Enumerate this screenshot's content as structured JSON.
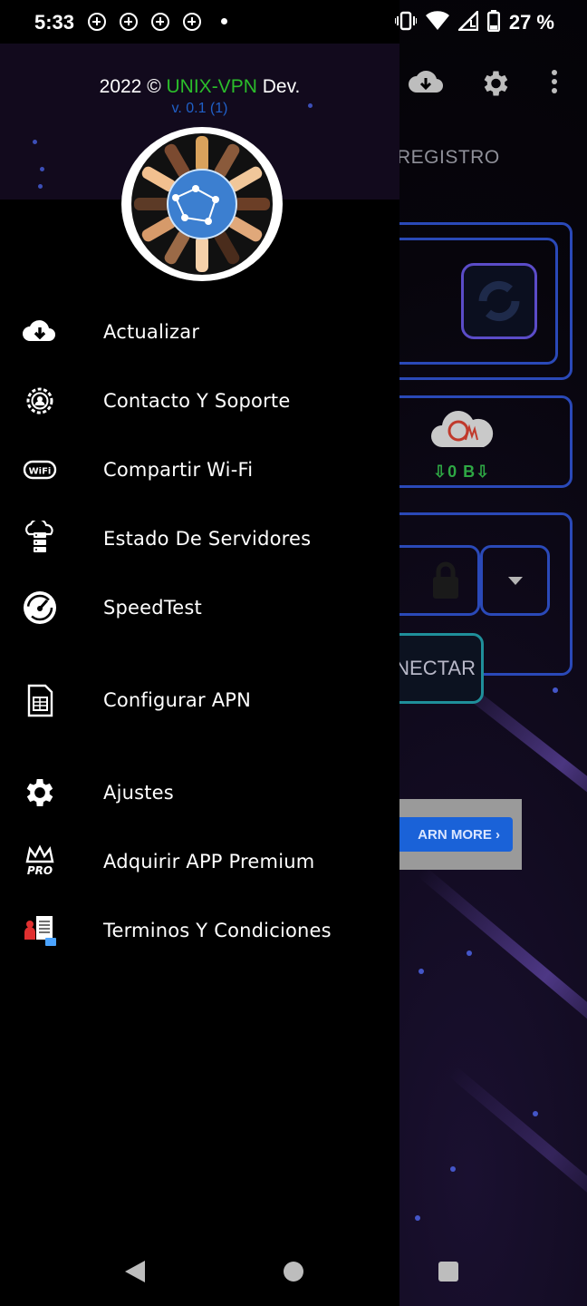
{
  "status_bar": {
    "time": "5:33",
    "battery_percent": "27 %",
    "notification_icons": [
      "vpn-key-icon",
      "vpn-key-icon",
      "vpn-key-icon",
      "vpn-key-icon"
    ]
  },
  "background_app": {
    "tab_registro": "REGISTRO",
    "connect_label": "NECTAR",
    "traffic_label": "⇩0 B⇩",
    "ad_button": "ARN MORE  ›"
  },
  "drawer": {
    "header": {
      "year": "2022 ©",
      "brand": "UNIX-VPN",
      "suffix": "Dev.",
      "version": "v. 0.1 (1)"
    },
    "menu": [
      {
        "label": "Actualizar",
        "icon": "cloud-download-icon"
      },
      {
        "label": "Contacto Y Soporte",
        "icon": "support-gear-icon"
      },
      {
        "label": "Compartir Wi-Fi",
        "icon": "wifi-share-icon"
      },
      {
        "label": "Estado De Servidores",
        "icon": "server-cloud-icon"
      },
      {
        "label": "SpeedTest",
        "icon": "speedometer-icon"
      },
      {
        "label": "Configurar APN",
        "icon": "sim-card-icon"
      },
      {
        "label": "Ajustes",
        "icon": "settings-gear-icon"
      },
      {
        "label": "Adquirir APP Premium",
        "icon": "crown-pro-icon"
      },
      {
        "label": "Terminos Y Condiciones",
        "icon": "terms-document-icon"
      }
    ]
  },
  "colors": {
    "brand_green": "#2bbd2b",
    "version_blue": "#2060c8",
    "drawer_header_bg": "#120a1d"
  }
}
